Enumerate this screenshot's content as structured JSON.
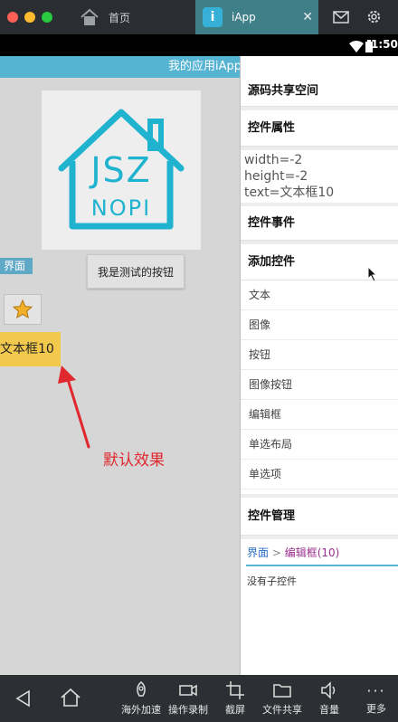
{
  "window": {
    "tabs": [
      {
        "label": "首页",
        "icon": "home-icon"
      },
      {
        "label": "iApp",
        "icon": "iapp-icon"
      }
    ],
    "toolbar_icons": [
      "mail-icon",
      "gear-icon"
    ]
  },
  "status": {
    "time": "1:50",
    "icons": [
      "wifi-icon",
      "signal-icon",
      "battery-icon"
    ]
  },
  "app": {
    "header_title": "我的应用iApp",
    "logo_line1": "JSZ",
    "logo_line2": "NOPI",
    "tag_label": "界面",
    "button_label": "我是测试的按钮",
    "textbox_text": "文本框10",
    "annotation": "默认效果"
  },
  "panel": {
    "sections": {
      "share": "源码共享空间",
      "props": "控件属性",
      "events": "控件事件",
      "add": "添加控件",
      "manage": "控件管理"
    },
    "props_lines": [
      "width=-2",
      "height=-2",
      "text=文本框10"
    ],
    "add_items": [
      "文本",
      "图像",
      "按钮",
      "图像按钮",
      "编辑框",
      "单选布局",
      "单选项"
    ],
    "breadcrumb": {
      "root": "界面",
      "sep": " > ",
      "current": "编辑框(10)"
    },
    "no_children": "没有子控件"
  },
  "bottom": {
    "items": [
      {
        "label": "海外加速",
        "icon": "rocket-icon"
      },
      {
        "label": "操作录制",
        "icon": "record-icon"
      },
      {
        "label": "截屏",
        "icon": "crop-icon"
      },
      {
        "label": "文件共享",
        "icon": "folder-icon"
      },
      {
        "label": "音量",
        "icon": "volume-icon"
      },
      {
        "label": "更多",
        "icon": "more-icon"
      }
    ]
  },
  "colors": {
    "accent": "#56b4d3",
    "textbox": "#f2c94c",
    "annotation": "#e0282e",
    "breadcrumb": "#9b2d8f"
  }
}
